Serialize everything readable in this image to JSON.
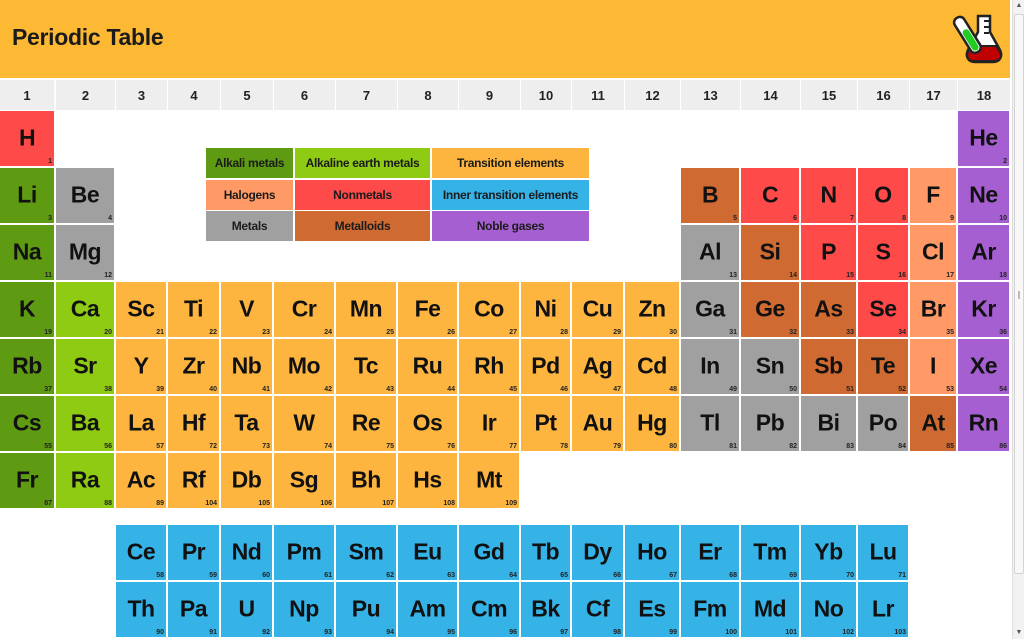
{
  "app": {
    "title": "Periodic Table",
    "logo_icon": "chemistry-flask-icon"
  },
  "colors": {
    "header_bar": "#FDB933",
    "column_header": "#EEEEEE",
    "alkali": "#5E9A12",
    "alkaline": "#8FCB12",
    "transition": "#FDB53F",
    "halogen": "#FF9966",
    "nonmetal": "#FF4A4A",
    "inner": "#35B2E6",
    "metal": "#A0A0A0",
    "metalloid": "#CF6A32",
    "noble": "#A65FD1"
  },
  "groups": [
    "1",
    "2",
    "3",
    "4",
    "5",
    "6",
    "7",
    "8",
    "9",
    "10",
    "11",
    "12",
    "13",
    "14",
    "15",
    "16",
    "17",
    "18"
  ],
  "legend": [
    {
      "key": "alkali",
      "label": "Alkali metals"
    },
    {
      "key": "alkaline",
      "label": "Alkaline earth metals"
    },
    {
      "key": "transition",
      "label": "Transition elements"
    },
    {
      "key": "halogen",
      "label": "Halogens"
    },
    {
      "key": "nonmetal",
      "label": "Nonmetals"
    },
    {
      "key": "inner",
      "label": "Inner transition elements"
    },
    {
      "key": "metal",
      "label": "Metals"
    },
    {
      "key": "metalloid",
      "label": "Metalloids"
    },
    {
      "key": "noble",
      "label": "Noble gases"
    }
  ],
  "elements": [
    {
      "s": "H",
      "n": 1,
      "g": 1,
      "p": 1,
      "c": "nonmetal"
    },
    {
      "s": "He",
      "n": 2,
      "g": 18,
      "p": 1,
      "c": "noble"
    },
    {
      "s": "Li",
      "n": 3,
      "g": 1,
      "p": 2,
      "c": "alkali"
    },
    {
      "s": "Be",
      "n": 4,
      "g": 2,
      "p": 2,
      "c": "metal"
    },
    {
      "s": "B",
      "n": 5,
      "g": 13,
      "p": 2,
      "c": "metalloid"
    },
    {
      "s": "C",
      "n": 6,
      "g": 14,
      "p": 2,
      "c": "nonmetal"
    },
    {
      "s": "N",
      "n": 7,
      "g": 15,
      "p": 2,
      "c": "nonmetal"
    },
    {
      "s": "O",
      "n": 8,
      "g": 16,
      "p": 2,
      "c": "nonmetal"
    },
    {
      "s": "F",
      "n": 9,
      "g": 17,
      "p": 2,
      "c": "halogen"
    },
    {
      "s": "Ne",
      "n": 10,
      "g": 18,
      "p": 2,
      "c": "noble"
    },
    {
      "s": "Na",
      "n": 11,
      "g": 1,
      "p": 3,
      "c": "alkali"
    },
    {
      "s": "Mg",
      "n": 12,
      "g": 2,
      "p": 3,
      "c": "metal"
    },
    {
      "s": "Al",
      "n": 13,
      "g": 13,
      "p": 3,
      "c": "metal"
    },
    {
      "s": "Si",
      "n": 14,
      "g": 14,
      "p": 3,
      "c": "metalloid"
    },
    {
      "s": "P",
      "n": 15,
      "g": 15,
      "p": 3,
      "c": "nonmetal"
    },
    {
      "s": "S",
      "n": 16,
      "g": 16,
      "p": 3,
      "c": "nonmetal"
    },
    {
      "s": "Cl",
      "n": 17,
      "g": 17,
      "p": 3,
      "c": "halogen"
    },
    {
      "s": "Ar",
      "n": 18,
      "g": 18,
      "p": 3,
      "c": "noble"
    },
    {
      "s": "K",
      "n": 19,
      "g": 1,
      "p": 4,
      "c": "alkali"
    },
    {
      "s": "Ca",
      "n": 20,
      "g": 2,
      "p": 4,
      "c": "alkaline"
    },
    {
      "s": "Sc",
      "n": 21,
      "g": 3,
      "p": 4,
      "c": "transition"
    },
    {
      "s": "Ti",
      "n": 22,
      "g": 4,
      "p": 4,
      "c": "transition"
    },
    {
      "s": "V",
      "n": 23,
      "g": 5,
      "p": 4,
      "c": "transition"
    },
    {
      "s": "Cr",
      "n": 24,
      "g": 6,
      "p": 4,
      "c": "transition"
    },
    {
      "s": "Mn",
      "n": 25,
      "g": 7,
      "p": 4,
      "c": "transition"
    },
    {
      "s": "Fe",
      "n": 26,
      "g": 8,
      "p": 4,
      "c": "transition"
    },
    {
      "s": "Co",
      "n": 27,
      "g": 9,
      "p": 4,
      "c": "transition"
    },
    {
      "s": "Ni",
      "n": 28,
      "g": 10,
      "p": 4,
      "c": "transition"
    },
    {
      "s": "Cu",
      "n": 29,
      "g": 11,
      "p": 4,
      "c": "transition"
    },
    {
      "s": "Zn",
      "n": 30,
      "g": 12,
      "p": 4,
      "c": "transition"
    },
    {
      "s": "Ga",
      "n": 31,
      "g": 13,
      "p": 4,
      "c": "metal"
    },
    {
      "s": "Ge",
      "n": 32,
      "g": 14,
      "p": 4,
      "c": "metalloid"
    },
    {
      "s": "As",
      "n": 33,
      "g": 15,
      "p": 4,
      "c": "metalloid"
    },
    {
      "s": "Se",
      "n": 34,
      "g": 16,
      "p": 4,
      "c": "nonmetal"
    },
    {
      "s": "Br",
      "n": 35,
      "g": 17,
      "p": 4,
      "c": "halogen"
    },
    {
      "s": "Kr",
      "n": 36,
      "g": 18,
      "p": 4,
      "c": "noble"
    },
    {
      "s": "Rb",
      "n": 37,
      "g": 1,
      "p": 5,
      "c": "alkali"
    },
    {
      "s": "Sr",
      "n": 38,
      "g": 2,
      "p": 5,
      "c": "alkaline"
    },
    {
      "s": "Y",
      "n": 39,
      "g": 3,
      "p": 5,
      "c": "transition"
    },
    {
      "s": "Zr",
      "n": 40,
      "g": 4,
      "p": 5,
      "c": "transition"
    },
    {
      "s": "Nb",
      "n": 41,
      "g": 5,
      "p": 5,
      "c": "transition"
    },
    {
      "s": "Mo",
      "n": 42,
      "g": 6,
      "p": 5,
      "c": "transition"
    },
    {
      "s": "Tc",
      "n": 43,
      "g": 7,
      "p": 5,
      "c": "transition"
    },
    {
      "s": "Ru",
      "n": 44,
      "g": 8,
      "p": 5,
      "c": "transition"
    },
    {
      "s": "Rh",
      "n": 45,
      "g": 9,
      "p": 5,
      "c": "transition"
    },
    {
      "s": "Pd",
      "n": 46,
      "g": 10,
      "p": 5,
      "c": "transition"
    },
    {
      "s": "Ag",
      "n": 47,
      "g": 11,
      "p": 5,
      "c": "transition"
    },
    {
      "s": "Cd",
      "n": 48,
      "g": 12,
      "p": 5,
      "c": "transition"
    },
    {
      "s": "In",
      "n": 49,
      "g": 13,
      "p": 5,
      "c": "metal"
    },
    {
      "s": "Sn",
      "n": 50,
      "g": 14,
      "p": 5,
      "c": "metal"
    },
    {
      "s": "Sb",
      "n": 51,
      "g": 15,
      "p": 5,
      "c": "metalloid"
    },
    {
      "s": "Te",
      "n": 52,
      "g": 16,
      "p": 5,
      "c": "metalloid"
    },
    {
      "s": "I",
      "n": 53,
      "g": 17,
      "p": 5,
      "c": "halogen"
    },
    {
      "s": "Xe",
      "n": 54,
      "g": 18,
      "p": 5,
      "c": "noble"
    },
    {
      "s": "Cs",
      "n": 55,
      "g": 1,
      "p": 6,
      "c": "alkali"
    },
    {
      "s": "Ba",
      "n": 56,
      "g": 2,
      "p": 6,
      "c": "alkaline"
    },
    {
      "s": "La",
      "n": 57,
      "g": 3,
      "p": 6,
      "c": "transition"
    },
    {
      "s": "Hf",
      "n": 72,
      "g": 4,
      "p": 6,
      "c": "transition"
    },
    {
      "s": "Ta",
      "n": 73,
      "g": 5,
      "p": 6,
      "c": "transition"
    },
    {
      "s": "W",
      "n": 74,
      "g": 6,
      "p": 6,
      "c": "transition"
    },
    {
      "s": "Re",
      "n": 75,
      "g": 7,
      "p": 6,
      "c": "transition"
    },
    {
      "s": "Os",
      "n": 76,
      "g": 8,
      "p": 6,
      "c": "transition"
    },
    {
      "s": "Ir",
      "n": 77,
      "g": 9,
      "p": 6,
      "c": "transition"
    },
    {
      "s": "Pt",
      "n": 78,
      "g": 10,
      "p": 6,
      "c": "transition"
    },
    {
      "s": "Au",
      "n": 79,
      "g": 11,
      "p": 6,
      "c": "transition"
    },
    {
      "s": "Hg",
      "n": 80,
      "g": 12,
      "p": 6,
      "c": "transition"
    },
    {
      "s": "Tl",
      "n": 81,
      "g": 13,
      "p": 6,
      "c": "metal"
    },
    {
      "s": "Pb",
      "n": 82,
      "g": 14,
      "p": 6,
      "c": "metal"
    },
    {
      "s": "Bi",
      "n": 83,
      "g": 15,
      "p": 6,
      "c": "metal"
    },
    {
      "s": "Po",
      "n": 84,
      "g": 16,
      "p": 6,
      "c": "metal"
    },
    {
      "s": "At",
      "n": 85,
      "g": 17,
      "p": 6,
      "c": "metalloid"
    },
    {
      "s": "Rn",
      "n": 86,
      "g": 18,
      "p": 6,
      "c": "noble"
    },
    {
      "s": "Fr",
      "n": 87,
      "g": 1,
      "p": 7,
      "c": "alkali"
    },
    {
      "s": "Ra",
      "n": 88,
      "g": 2,
      "p": 7,
      "c": "alkaline"
    },
    {
      "s": "Ac",
      "n": 89,
      "g": 3,
      "p": 7,
      "c": "transition"
    },
    {
      "s": "Rf",
      "n": 104,
      "g": 4,
      "p": 7,
      "c": "transition"
    },
    {
      "s": "Db",
      "n": 105,
      "g": 5,
      "p": 7,
      "c": "transition"
    },
    {
      "s": "Sg",
      "n": 106,
      "g": 6,
      "p": 7,
      "c": "transition"
    },
    {
      "s": "Bh",
      "n": 107,
      "g": 7,
      "p": 7,
      "c": "transition"
    },
    {
      "s": "Hs",
      "n": 108,
      "g": 8,
      "p": 7,
      "c": "transition"
    },
    {
      "s": "Mt",
      "n": 109,
      "g": 9,
      "p": 7,
      "c": "transition"
    },
    {
      "s": "Ce",
      "n": 58,
      "g": 3,
      "p": 8,
      "c": "inner"
    },
    {
      "s": "Pr",
      "n": 59,
      "g": 4,
      "p": 8,
      "c": "inner"
    },
    {
      "s": "Nd",
      "n": 60,
      "g": 5,
      "p": 8,
      "c": "inner"
    },
    {
      "s": "Pm",
      "n": 61,
      "g": 6,
      "p": 8,
      "c": "inner"
    },
    {
      "s": "Sm",
      "n": 62,
      "g": 7,
      "p": 8,
      "c": "inner"
    },
    {
      "s": "Eu",
      "n": 63,
      "g": 8,
      "p": 8,
      "c": "inner"
    },
    {
      "s": "Gd",
      "n": 64,
      "g": 9,
      "p": 8,
      "c": "inner"
    },
    {
      "s": "Tb",
      "n": 65,
      "g": 10,
      "p": 8,
      "c": "inner"
    },
    {
      "s": "Dy",
      "n": 66,
      "g": 11,
      "p": 8,
      "c": "inner"
    },
    {
      "s": "Ho",
      "n": 67,
      "g": 12,
      "p": 8,
      "c": "inner"
    },
    {
      "s": "Er",
      "n": 68,
      "g": 13,
      "p": 8,
      "c": "inner"
    },
    {
      "s": "Tm",
      "n": 69,
      "g": 14,
      "p": 8,
      "c": "inner"
    },
    {
      "s": "Yb",
      "n": 70,
      "g": 15,
      "p": 8,
      "c": "inner"
    },
    {
      "s": "Lu",
      "n": 71,
      "g": 16,
      "p": 8,
      "c": "inner"
    },
    {
      "s": "Th",
      "n": 90,
      "g": 3,
      "p": 9,
      "c": "inner"
    },
    {
      "s": "Pa",
      "n": 91,
      "g": 4,
      "p": 9,
      "c": "inner"
    },
    {
      "s": "U",
      "n": 92,
      "g": 5,
      "p": 9,
      "c": "inner"
    },
    {
      "s": "Np",
      "n": 93,
      "g": 6,
      "p": 9,
      "c": "inner"
    },
    {
      "s": "Pu",
      "n": 94,
      "g": 7,
      "p": 9,
      "c": "inner"
    },
    {
      "s": "Am",
      "n": 95,
      "g": 8,
      "p": 9,
      "c": "inner"
    },
    {
      "s": "Cm",
      "n": 96,
      "g": 9,
      "p": 9,
      "c": "inner"
    },
    {
      "s": "Bk",
      "n": 97,
      "g": 10,
      "p": 9,
      "c": "inner"
    },
    {
      "s": "Cf",
      "n": 98,
      "g": 11,
      "p": 9,
      "c": "inner"
    },
    {
      "s": "Es",
      "n": 99,
      "g": 12,
      "p": 9,
      "c": "inner"
    },
    {
      "s": "Fm",
      "n": 100,
      "g": 13,
      "p": 9,
      "c": "inner"
    },
    {
      "s": "Md",
      "n": 101,
      "g": 14,
      "p": 9,
      "c": "inner"
    },
    {
      "s": "No",
      "n": 102,
      "g": 15,
      "p": 9,
      "c": "inner"
    },
    {
      "s": "Lr",
      "n": 103,
      "g": 16,
      "p": 9,
      "c": "inner"
    }
  ],
  "scrollbar": {
    "up_icon": "▲",
    "down_icon": "▼"
  }
}
